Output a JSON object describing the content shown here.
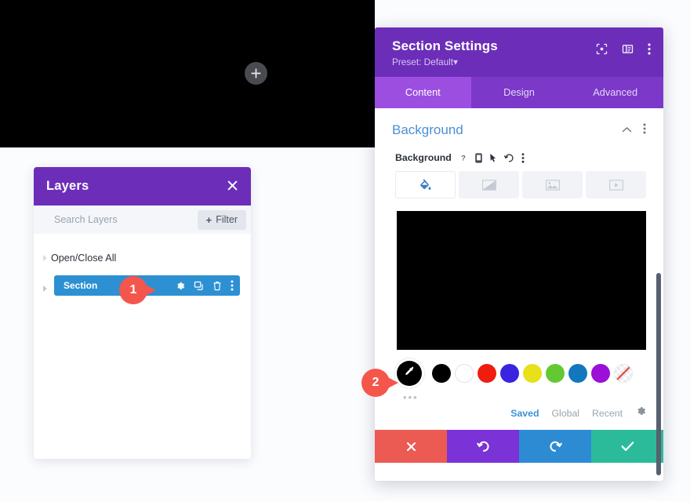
{
  "canvas": {
    "add_button_icon": "plus-icon"
  },
  "layers_panel": {
    "title": "Layers",
    "close_icon": "close-icon",
    "search_placeholder": "Search Layers",
    "filter_label": "Filter",
    "filter_plus": "+",
    "rows": [
      {
        "label": "Open/Close All",
        "selected": false
      },
      {
        "label": "Section",
        "selected": true
      }
    ],
    "row_icons": [
      "gear-icon",
      "duplicate-icon",
      "trash-icon",
      "kebab-menu-icon"
    ]
  },
  "modal": {
    "title": "Section Settings",
    "preset": "Preset: Default",
    "preset_caret": "▾",
    "header_icons": [
      "fullscreen-icon",
      "layout-panel-icon",
      "kebab-menu-icon"
    ],
    "tabs": [
      {
        "label": "Content",
        "active": true
      },
      {
        "label": "Design",
        "active": false
      },
      {
        "label": "Advanced",
        "active": false
      }
    ],
    "section": {
      "title": "Background",
      "collapse_icon": "chevron-up-icon",
      "kebab_icon": "kebab-menu-icon"
    },
    "field": {
      "label": "Background",
      "icons": [
        "help-icon",
        "responsive-icon",
        "hover-icon",
        "reset-icon",
        "kebab-menu-icon"
      ]
    },
    "background_types": [
      {
        "name": "color",
        "icon": "paint-bucket-icon",
        "active": true
      },
      {
        "name": "gradient",
        "icon": "gradient-icon",
        "active": false
      },
      {
        "name": "image",
        "icon": "image-icon",
        "active": false
      },
      {
        "name": "video",
        "icon": "video-icon",
        "active": false
      }
    ],
    "preview_color": "#000000",
    "swatches": [
      {
        "name": "eyedropper",
        "color": "#000000",
        "type": "eyedropper"
      },
      {
        "name": "black",
        "color": "#000000",
        "type": "solid"
      },
      {
        "name": "white",
        "color": "#ffffff",
        "type": "white"
      },
      {
        "name": "red",
        "color": "#f01c10",
        "type": "solid"
      },
      {
        "name": "blue",
        "color": "#3a24e0",
        "type": "solid"
      },
      {
        "name": "yellow",
        "color": "#e8e019",
        "type": "solid"
      },
      {
        "name": "green",
        "color": "#64c832",
        "type": "solid"
      },
      {
        "name": "teal-blue",
        "color": "#1277bf",
        "type": "solid"
      },
      {
        "name": "purple",
        "color": "#9b0fd6",
        "type": "solid"
      },
      {
        "name": "transparent",
        "color": "transparent",
        "type": "transparent"
      }
    ],
    "more_dots": "•••",
    "palette_tabs": [
      {
        "label": "Saved",
        "active": true
      },
      {
        "label": "Global",
        "active": false
      },
      {
        "label": "Recent",
        "active": false
      }
    ],
    "palette_gear_icon": "gear-icon",
    "footer": [
      {
        "name": "cancel",
        "icon": "close-icon",
        "color": "#eb5a53"
      },
      {
        "name": "undo",
        "icon": "undo-icon",
        "color": "#7b32d6"
      },
      {
        "name": "redo",
        "icon": "redo-icon",
        "color": "#2d8bd4"
      },
      {
        "name": "save",
        "icon": "check-icon",
        "color": "#2bbb9b"
      }
    ]
  },
  "markers": [
    {
      "number": "1"
    },
    {
      "number": "2"
    }
  ]
}
